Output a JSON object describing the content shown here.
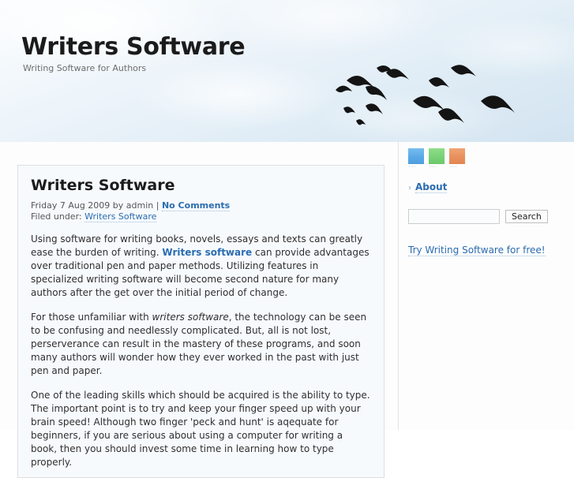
{
  "site": {
    "title": "Writers Software",
    "tagline": "Writing Software for Authors"
  },
  "post": {
    "title": "Writers Software",
    "meta_prefix": "Friday 7 Aug 2009 by admin |",
    "comments_label": "No Comments",
    "filed_under_label": "Filed under:",
    "category_label": "Writers Software",
    "paragraph1": {
      "a": "Using software for writing books, novels, essays and texts can greatly ease the burden of writing. ",
      "link": "Writers software",
      "b": " can provide advantages over traditional pen and paper methods. Utilizing features in specialized writing software will become second nature for many authors after the get over the initial period of change."
    },
    "paragraph2": {
      "a": "For those unfamiliar with ",
      "em": "writers software",
      "b": ", the technology can be seen to be confusing and needlessly complicated. But, all is not lost, perserverance can result in the mastery of these programs, and soon many authors will wonder how they ever worked in the past with just pen and paper."
    },
    "paragraph3": "One of the leading skills which should be acquired is the ability to type. The important point is to try and keep your finger speed up with your brain speed! Although two finger 'peck and hunt' is aqequate for beginners, if you are serious about using a computer for writing a book, then you should invest some time in learning how to type properly."
  },
  "sidebar": {
    "social_icons": [
      {
        "name": "social-icon-blue",
        "color": "#5aa9e6",
        "caption": "share"
      },
      {
        "name": "social-icon-green",
        "color": "#79d275",
        "caption": "share"
      },
      {
        "name": "social-icon-orange",
        "color": "#e8905c",
        "caption": "share"
      }
    ],
    "nav": [
      {
        "label": "About",
        "chevron": "›"
      }
    ],
    "search": {
      "value": "",
      "placeholder": "",
      "button_label": "Search"
    },
    "promo_link": "Try Writing Software for free!"
  },
  "colors": {
    "link": "#2b6cb0",
    "banner_sky": "#d6e6f2",
    "content_bg": "#f7fafd"
  }
}
